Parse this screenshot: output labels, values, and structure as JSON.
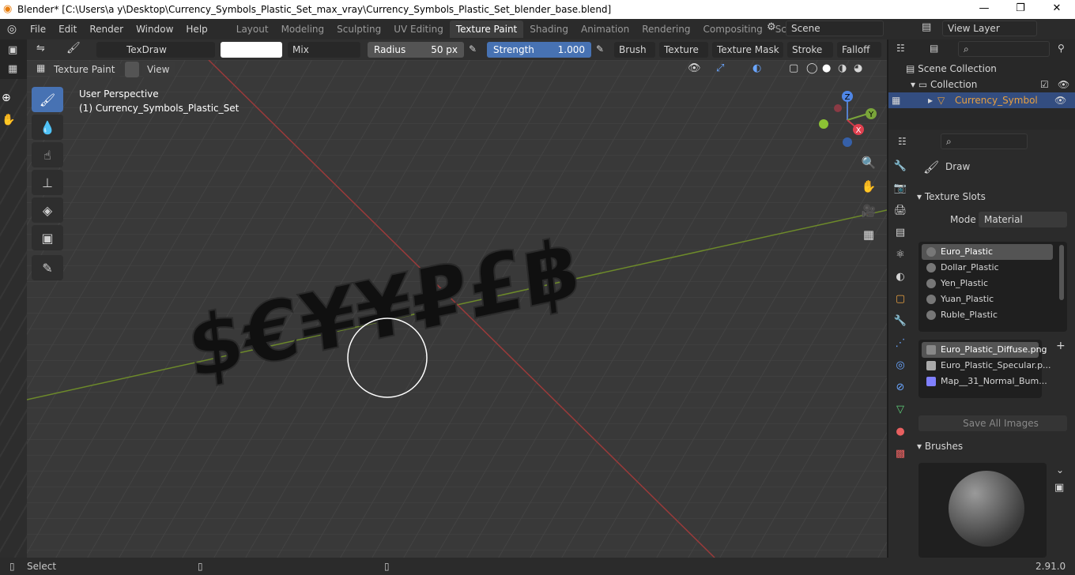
{
  "window": {
    "title": "Blender* [C:\\Users\\a y\\Desktop\\Currency_Symbols_Plastic_Set_max_vray\\Currency_Symbols_Plastic_Set_blender_base.blend]",
    "minimize": "—",
    "maximize": "❐",
    "close": "✕"
  },
  "menubar": {
    "items": [
      "File",
      "Edit",
      "Render",
      "Window",
      "Help"
    ],
    "workspaces": [
      "Layout",
      "Modeling",
      "Sculpting",
      "UV Editing",
      "Texture Paint",
      "Shading",
      "Animation",
      "Rendering",
      "Compositing",
      "Scripting"
    ],
    "active_workspace": "Texture Paint",
    "add_workspace": "+",
    "scene": "Scene",
    "view_layer": "View Layer"
  },
  "tool_header": {
    "brush_name": "TexDraw",
    "blend_mode": "Mix",
    "radius_label": "Radius",
    "radius_value": "50 px",
    "strength_label": "Strength",
    "strength_value": "1.000",
    "menus": [
      "Brush",
      "Texture",
      "Texture Mask",
      "Stroke",
      "Falloff"
    ]
  },
  "view_header": {
    "mode": "Texture Paint",
    "view_menu": "View"
  },
  "viewport": {
    "perspective": "User Perspective",
    "object": "(1) Currency_Symbols_Plastic_Set",
    "symbols": "$€¥¥₽£฿",
    "gizmo_z": "Z",
    "gizmo_y": "Y",
    "gizmo_x": "X"
  },
  "outliner": {
    "scene_collection": "Scene Collection",
    "collection": "Collection",
    "object": "Currency_Symbols_P"
  },
  "properties": {
    "active_tool": "Draw",
    "texture_slots_title": "Texture Slots",
    "mode_label": "Mode",
    "mode_value": "Material",
    "materials": [
      "Euro_Plastic",
      "Dollar_Plastic",
      "Yen_Plastic",
      "Yuan_Plastic",
      "Ruble_Plastic"
    ],
    "images": [
      "Euro_Plastic_Diffuse.png",
      "Euro_Plastic_Specular.p...",
      "Map__31_Normal_Bum..."
    ],
    "save_all": "Save All Images",
    "brushes_title": "Brushes"
  },
  "statusbar": {
    "select": "Select",
    "version": "2.91.0"
  },
  "colors": {
    "accent": "#4772b3",
    "active_orange": "#e87d0d"
  }
}
